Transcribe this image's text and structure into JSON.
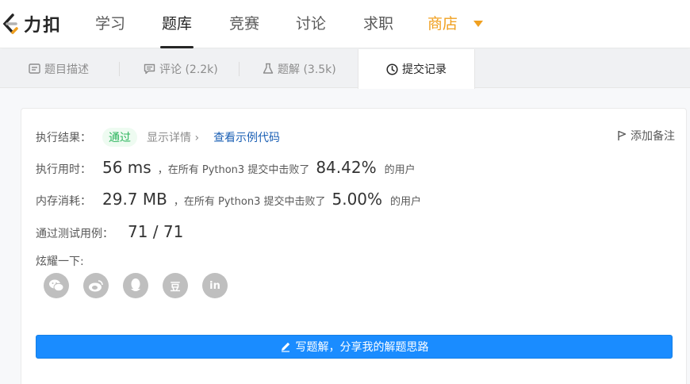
{
  "nav": {
    "logo_text": "力扣",
    "items": [
      {
        "label": "学习"
      },
      {
        "label": "题库"
      },
      {
        "label": "竞赛"
      },
      {
        "label": "讨论"
      },
      {
        "label": "求职"
      },
      {
        "label": "商店"
      }
    ],
    "store_color": "#f0a020"
  },
  "tabs": [
    {
      "label": "题目描述",
      "icon": "description-icon"
    },
    {
      "label": "评论 (2.2k)",
      "icon": "comment-icon"
    },
    {
      "label": "题解 (3.5k)",
      "icon": "flask-icon"
    },
    {
      "label": "提交记录",
      "icon": "clock-icon"
    }
  ],
  "result": {
    "label": "执行结果：",
    "status": "通过",
    "details": "显示详情 ›",
    "example": "查看示例代码",
    "note": "添加备注",
    "status_color": "#2db55d"
  },
  "runtime": {
    "label": "执行用时：",
    "value": "56 ms",
    "beat_text": "，在所有 Python3 提交中击败了",
    "percent": "84.42%",
    "users": "的用户"
  },
  "memory": {
    "label": "内存消耗：",
    "value": "29.7 MB",
    "beat_text": "，在所有 Python3 提交中击败了",
    "percent": "5.00%",
    "users": "的用户"
  },
  "tests": {
    "label": "通过测试用例：",
    "value": "71 / 71"
  },
  "share": {
    "label": "炫耀一下:",
    "icons": [
      "wechat-icon",
      "weibo-icon",
      "qq-icon",
      "douban-icon",
      "linkedin-icon"
    ],
    "douban_text": "豆",
    "linkedin_text": "in"
  },
  "solution_button": {
    "label": "写题解，分享我的解题思路",
    "color": "#1a8cff"
  }
}
